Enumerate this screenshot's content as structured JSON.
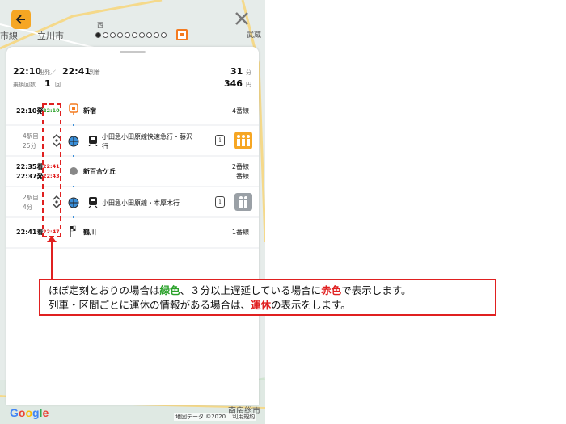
{
  "map": {
    "labels": [
      "市線",
      "立川市",
      "南房総市",
      "西",
      "武蔵"
    ],
    "google_logo": "Google",
    "attribution": "地図データ ©2020",
    "terms": "利用規約",
    "page_dots": 10,
    "active_dot": 0
  },
  "summary": {
    "depart_time": "22:10",
    "depart_label": "出発／",
    "arrive_time": "22:41",
    "arrive_label": "到着",
    "duration_value": "31",
    "duration_unit": "分",
    "transfers_label": "乗換回数",
    "transfers_value": "1",
    "transfers_unit": "回",
    "fare_value": "346",
    "fare_unit": "円"
  },
  "route": {
    "stops": [
      {
        "name": "新宿",
        "sched": "22:10発",
        "realtime": "22:10",
        "rt_color": "green",
        "track": "4番線"
      },
      {
        "name": "新百合ケ丘",
        "sched_arr": "22:35着",
        "rt_arr": "22:41",
        "sched_dep": "22:37発",
        "rt_dep": "22:43",
        "track_arr": "2番線",
        "track_dep": "1番線"
      },
      {
        "name": "鶴川",
        "sched": "22:41着",
        "realtime": "22:47",
        "rt_color": "red",
        "track": "1番線"
      }
    ],
    "segments": [
      {
        "stations": "4駅目",
        "minutes": "25分",
        "train_line1": "小田急小田原線快速急行・藤沢",
        "train_line2": "行",
        "info": "i"
      },
      {
        "stations": "2駅目",
        "minutes": "4分",
        "train_line1": "小田急小田原線・本厚木行",
        "info": "i"
      }
    ]
  },
  "callout": {
    "l1_a": "ほぼ定刻とおりの場合は",
    "l1_green": "緑色",
    "l1_b": "、３分以上遅延している場合に",
    "l1_red": "赤色",
    "l1_c": "で表示します。",
    "l2_a": "列車・区間ごとに運休の情報がある場合は、",
    "l2_red": "運休",
    "l2_b": "の表示をします。"
  },
  "colors": {
    "accent": "#f6a623",
    "line": "#3a8fd9",
    "green": "#2aa12a",
    "red": "#e02020",
    "crowd_busy": "#f6a623",
    "crowd_normal": "#9aa0a6"
  }
}
